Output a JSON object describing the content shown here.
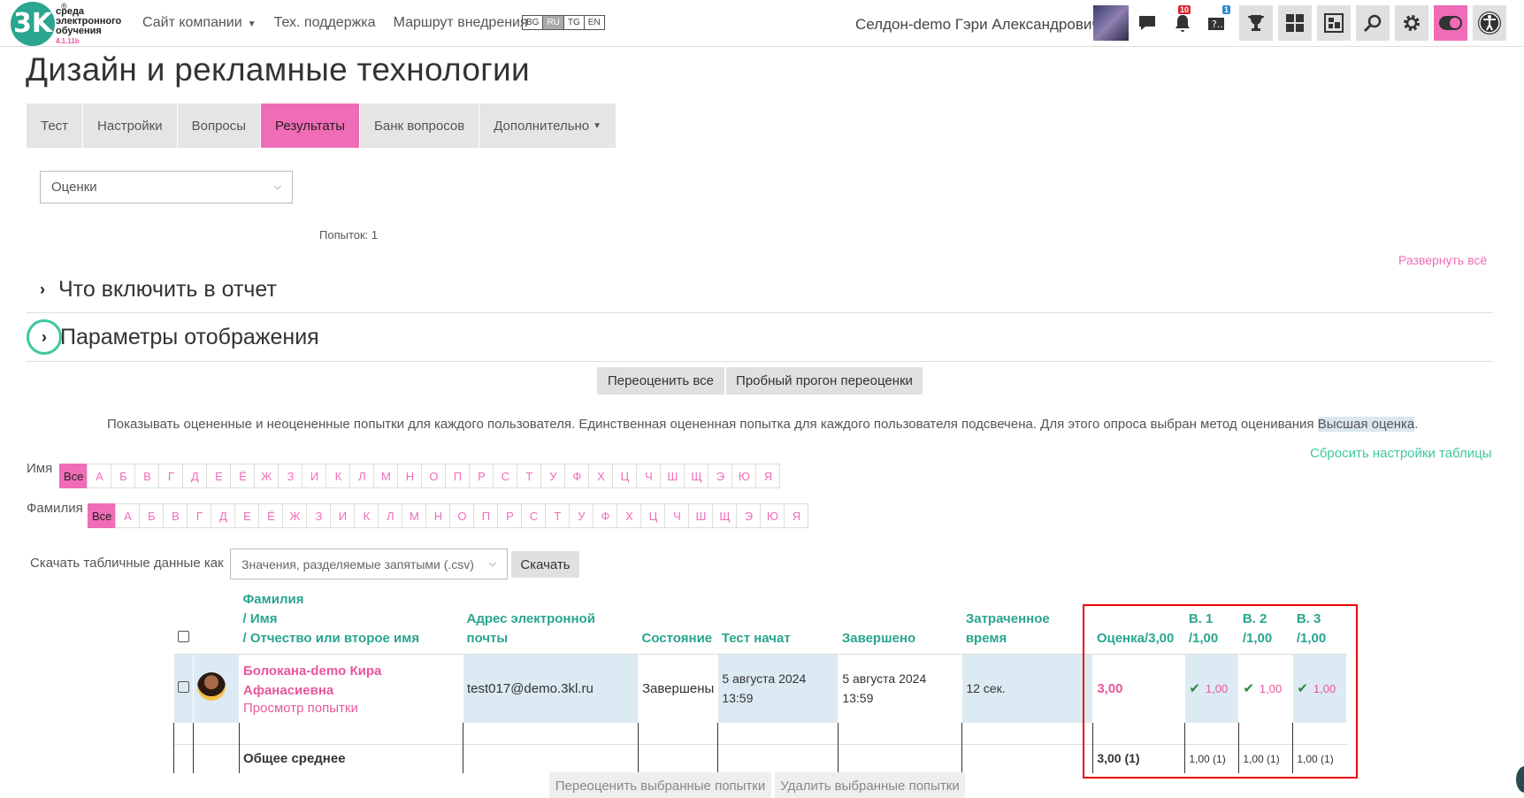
{
  "logo": {
    "mark": "3K",
    "line1": "среда",
    "line2": "электронного",
    "line3": "обучения",
    "version": "4.1.11b",
    "reg": "®"
  },
  "nav": {
    "links": [
      "Сайт компании",
      "Тех. поддержка",
      "Маршрут внедрения"
    ],
    "dropdown_caret": "⌄"
  },
  "langs": [
    "BG",
    "RU",
    "TG",
    "EN"
  ],
  "active_lang": "RU",
  "user": {
    "name": "Селдон-demo Гэри Александрович"
  },
  "notifications": {
    "bell_count": "10",
    "questions_count": "1"
  },
  "page_title": "Дизайн и рекламные технологии",
  "tabs": [
    "Тест",
    "Настройки",
    "Вопросы",
    "Результаты",
    "Банк вопросов",
    "Дополнительно"
  ],
  "active_tab": "Результаты",
  "report_select": "Оценки",
  "attempts_text": "Попыток: 1",
  "expand_all": "Развернуть всё",
  "sections": {
    "include": "Что включить в отчет",
    "display": "Параметры отображения"
  },
  "buttons": {
    "regrade_all": "Переоценить все",
    "dry_run": "Пробный прогон переоценки",
    "download": "Скачать",
    "regrade_selected": "Переоценить выбранные попытки",
    "delete_selected": "Удалить выбранные попытки"
  },
  "info": {
    "text": "Показывать оцененные и неоцененные попытки для каждого пользователя. Единственная оцененная попытка для каждого пользователя подсвечена. Для этого опроса выбран метод оценивания ",
    "method": "Высшая оценка",
    "end": "."
  },
  "reset_table": "Сбросить настройки таблицы",
  "filters": {
    "first_name_label": "Имя",
    "last_name_label": "Фамилия",
    "all": "Все",
    "letters": [
      "А",
      "Б",
      "В",
      "Г",
      "Д",
      "Е",
      "Ё",
      "Ж",
      "З",
      "И",
      "К",
      "Л",
      "М",
      "Н",
      "О",
      "П",
      "Р",
      "С",
      "Т",
      "У",
      "Ф",
      "Х",
      "Ц",
      "Ч",
      "Ш",
      "Щ",
      "Э",
      "Ю",
      "Я"
    ]
  },
  "download": {
    "label": "Скачать табличные данные как",
    "format": "Значения, разделяемые запятыми (.csv)"
  },
  "table": {
    "headers": {
      "name_line1": "Фамилия",
      "name_line2": "/ Имя",
      "name_line3": "/ Отчество или второе имя",
      "email_line1": "Адрес электронной",
      "email_line2": "почты",
      "state": "Состояние",
      "started": "Тест начат",
      "finished": "Завершено",
      "time_line1": "Затраченное",
      "time_line2": "время",
      "grade": "Оценка/3,00",
      "q1_line1": "В. 1",
      "q1_line2": "/1,00",
      "q2_line1": "В. 2",
      "q2_line2": "/1,00",
      "q3_line1": "В. 3",
      "q3_line2": "/1,00"
    },
    "row": {
      "name_line1": "Болокана-demo Кира",
      "name_line2": "Афанасиевна",
      "review": "Просмотр попытки",
      "email": "test017@demo.3kl.ru",
      "state": "Завершены",
      "started_line1": "5 августа 2024",
      "started_line2": "13:59",
      "finished_line1": "5 августа 2024",
      "finished_line2": "13:59",
      "time": "12 сек.",
      "grade": "3,00",
      "q1": "1,00",
      "q2": "1,00",
      "q3": "1,00"
    },
    "average": {
      "label": "Общее среднее",
      "grade": "3,00 (1)",
      "q1": "1,00 (1)",
      "q2": "1,00 (1)",
      "q3": "1,00 (1)"
    }
  }
}
